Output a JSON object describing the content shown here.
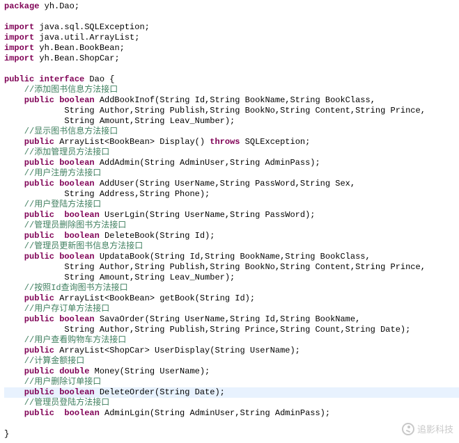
{
  "code": {
    "package_kw": "package",
    "package_name": " yh.Dao;",
    "import_kw": "import",
    "imports": [
      " java.sql.SQLException;",
      " java.util.ArrayList;",
      " yh.Bean.BookBean;",
      " yh.Bean.ShopCar;"
    ],
    "class_decl": {
      "public": "public",
      "interface": "interface",
      "name": " Dao {"
    },
    "body": {
      "c1": "    //添加图书信息方法接口",
      "m1a": "    public boolean",
      "m1b": " AddBookInof(String Id,String BookName,String BookClass,",
      "m1c": "            String Author,String Publish,String BookNo,String Content,String Prince,",
      "m1d": "            String Amount,String Leav_Number);",
      "c2": "    //显示图书信息方法接口",
      "m2a": "    public",
      "m2b": " ArrayList<BookBean> Display() ",
      "m2c": "throws",
      "m2d": " SQLException;",
      "c3": "    //添加管理员方法接口",
      "m3a": "    public boolean",
      "m3b": " AddAdmin(String AdminUser,String AdminPass);",
      "c4": "    //用户注册方法接口",
      "m4a": "    public boolean",
      "m4b": " AddUser(String UserName,String PassWord,String Sex,",
      "m4c": "            String Address,String Phone);",
      "c5": "    //用户登陆方法接口",
      "m5a": "    public  boolean",
      "m5b": " UserLgin(String UserName,String PassWord);",
      "c6": "    //管理员删除图书方法接口",
      "m6a": "    public  boolean",
      "m6b": " DeleteBook(String Id);",
      "c7": "    //管理员更新图书信息方法接口",
      "m7a": "    public boolean",
      "m7b": " UpdataBook(String Id,String BookName,String BookClass,",
      "m7c": "            String Author,String Publish,String BookNo,String Content,String Prince,",
      "m7d": "            String Amount,String Leav_Number);",
      "c8": "    //按照Id查询图书方法接口",
      "m8a": "    public",
      "m8b": " ArrayList<BookBean> getBook(String Id);",
      "c9": "    //用户存订单方法接口",
      "m9a": "    public boolean",
      "m9b": " SavaOrder(String UserName,String Id,String BookName,",
      "m9c": "            String Author,String Publish,String Prince,String Count,String Date);",
      "c10": "    //用户查看购物车方法接口",
      "m10a": "    public",
      "m10b": " ArrayList<ShopCar> UserDisplay(String UserName);",
      "c11": "    //计算金额接口",
      "m11a": "    public double",
      "m11b": " Money(String UserName);",
      "c12": "    //用户删除订单接口",
      "m12a": "    public boolean",
      "m12b": " DeleteOrder(String Date);",
      "c13": "    //管理员登陆方法接口",
      "m13a": "    public  boolean",
      "m13b": " AdminLgin(String AdminUser,String AdminPass);"
    },
    "close": "}"
  },
  "watermark": {
    "text": "追影科技"
  }
}
